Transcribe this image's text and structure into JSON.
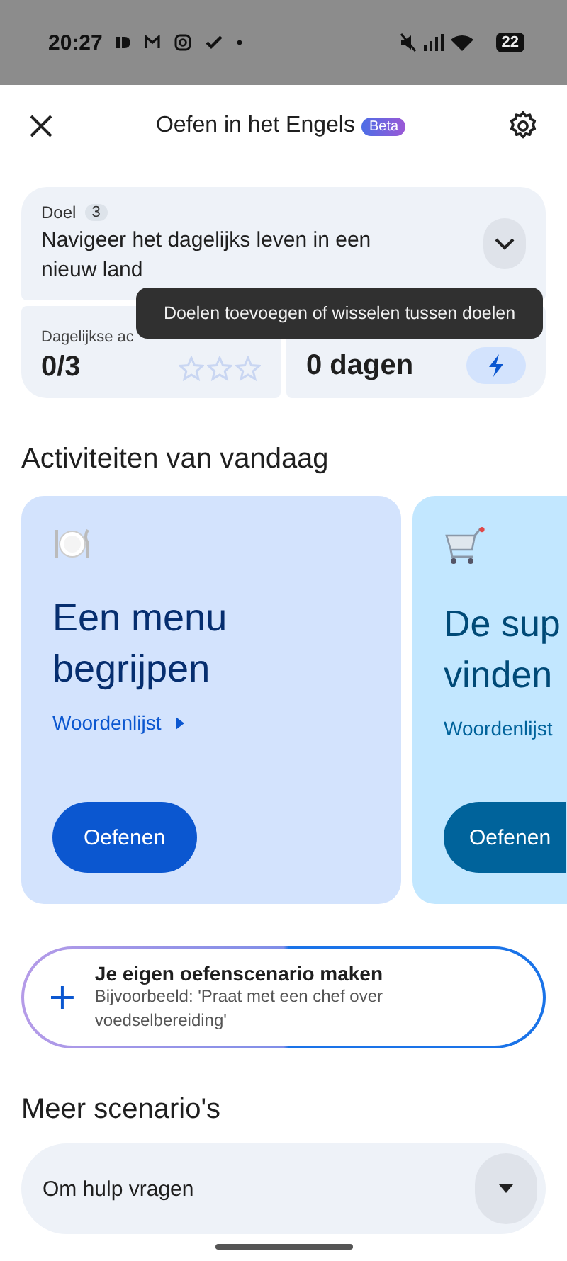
{
  "status_bar": {
    "time": "20:27",
    "battery": "22"
  },
  "header": {
    "title": "Oefen in het Engels",
    "badge": "Beta"
  },
  "goal": {
    "label": "Doel",
    "count": "3",
    "text": "Navigeer het dagelijks leven in een nieuw land",
    "expanded": false
  },
  "tooltip": "Doelen toevoegen of wisselen tussen doelen",
  "stats": [
    {
      "kind": "stars",
      "label": "Dagelijkse ac",
      "value": "0/3",
      "stars": 0
    },
    {
      "kind": "streak",
      "value": "0 dagen"
    }
  ],
  "activities": {
    "title": "Activiteiten van vandaag",
    "cards": [
      {
        "kind": "plate",
        "title": "Een menu begrijpen",
        "link": "Woordenlijst",
        "caret": true,
        "button": "Oefenen",
        "color": "#d3e3fd"
      },
      {
        "kind": "cart",
        "title": "De sup vinden",
        "link": "Woordenlijst",
        "caret": false,
        "button": "Oefenen",
        "color": "#c2e7ff"
      }
    ]
  },
  "create": {
    "title": "Je eigen oefenscenario maken",
    "subtitle": "Bijvoorbeeld: 'Praat met een chef over voedselbereiding'"
  },
  "more": {
    "title": "Meer scenario's",
    "selected": "Om hulp vragen"
  }
}
